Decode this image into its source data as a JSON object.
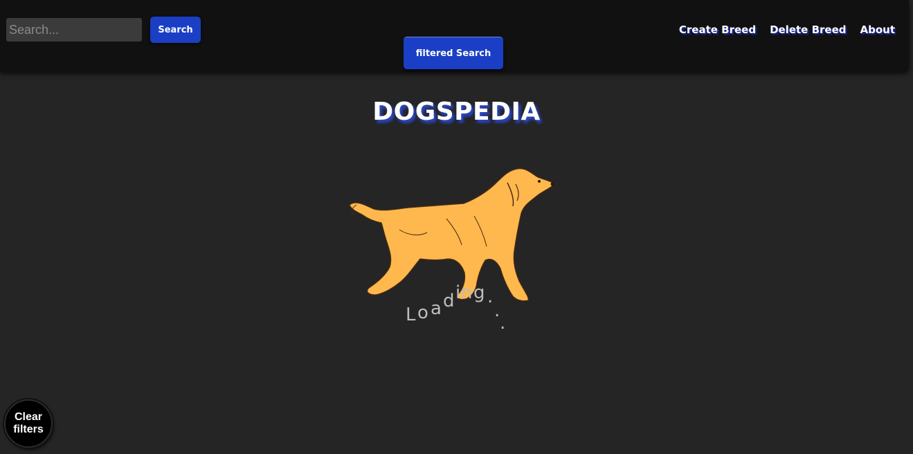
{
  "header": {
    "search": {
      "placeholder": "Search...",
      "value": ""
    },
    "search_button_label": "Search",
    "filtered_search_label": "filtered Search",
    "nav": [
      {
        "label": "Create Breed"
      },
      {
        "label": "Delete Breed"
      },
      {
        "label": "About"
      }
    ]
  },
  "main": {
    "title": "DOGSPEDIA",
    "loading_letters": [
      "L",
      "o",
      "a",
      "d",
      "i",
      "n",
      "g",
      ".",
      ".",
      "."
    ],
    "illustration_icon": "running-dog-illustration"
  },
  "floating": {
    "clear_filters_label": "Clear filters"
  },
  "colors": {
    "background": "#252525",
    "navbar": "#111111",
    "accent_blue": "#1a3fc4",
    "dog_fill": "#ffb84d"
  }
}
